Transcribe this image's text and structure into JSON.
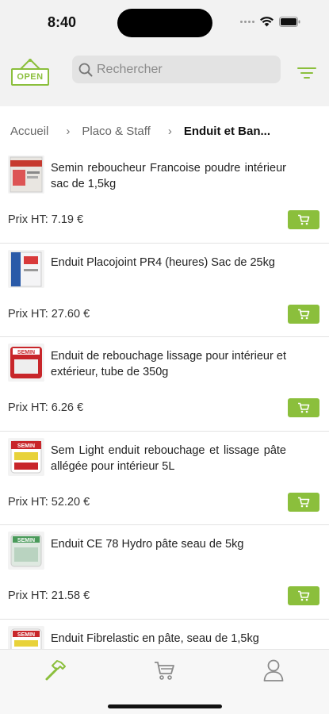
{
  "status": {
    "time": "8:40"
  },
  "header": {
    "logo_text": "OPEN",
    "search_placeholder": "Rechercher"
  },
  "breadcrumb": [
    "Accueil",
    "Placo & Staff",
    "Enduit et Ban..."
  ],
  "products": [
    {
      "name": "Semin reboucheur Francoise poudre intérieur sac de 1,5kg",
      "price": "Prix HT: 7.19 €",
      "thumb_color": "#c63a2f"
    },
    {
      "name": "Enduit Placojoint PR4 (heures) Sac de 25kg",
      "price": "Prix HT: 27.60 €",
      "thumb_color": "#2a5aa8"
    },
    {
      "name": "Enduit de rebouchage lissage pour intérieur et extérieur, tube de 350g",
      "price": "Prix HT: 6.26 €",
      "thumb_color": "#c8262a"
    },
    {
      "name": "Sem Light enduit rebouchage et lissage pâte allégée pour intérieur 5L",
      "price": "Prix HT: 52.20 €",
      "thumb_color": "#c8262a"
    },
    {
      "name": "Enduit CE 78 Hydro pâte seau de 5kg",
      "price": "Prix HT: 21.58 €",
      "thumb_color": "#4a9a5a"
    },
    {
      "name": "Enduit Fibrelastic en pâte, seau de 1,5kg",
      "price": "",
      "thumb_color": "#c8262a"
    }
  ],
  "colors": {
    "accent": "#8bbf3c"
  },
  "tabs": [
    "hammer-icon",
    "cart-icon",
    "user-icon"
  ]
}
